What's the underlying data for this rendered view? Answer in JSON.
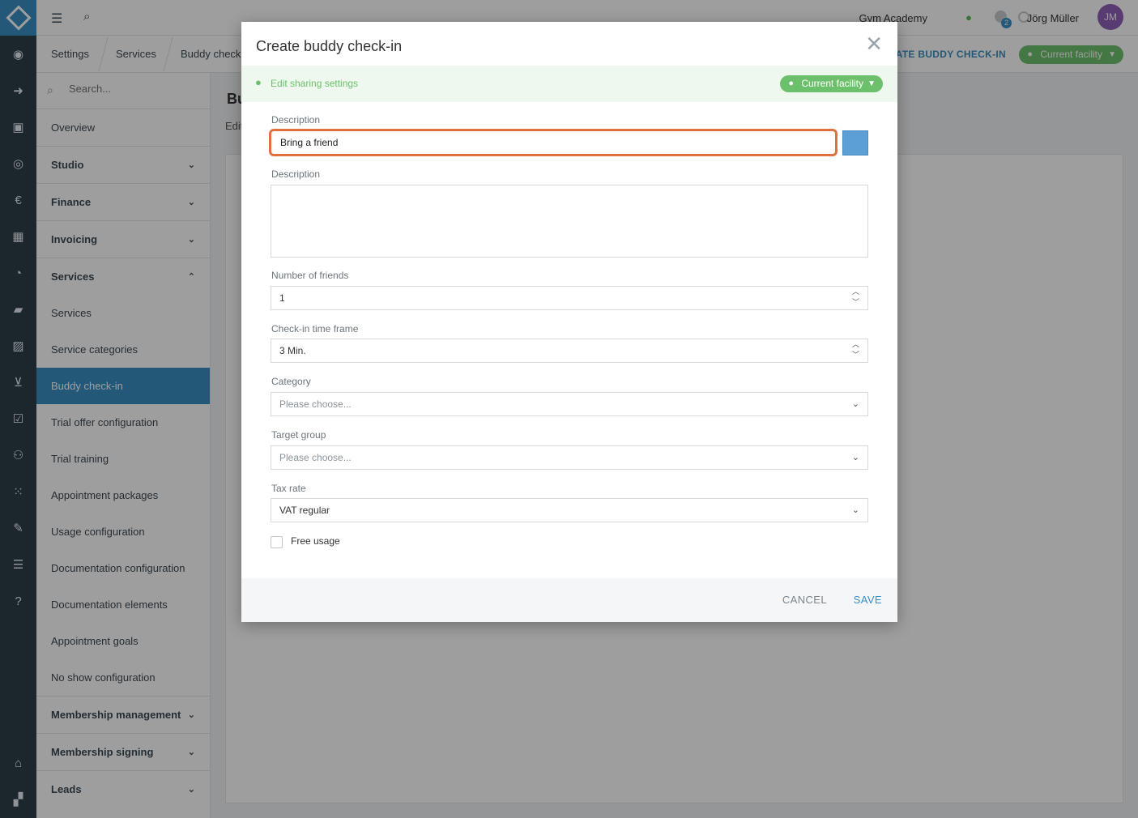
{
  "topbar": {
    "studio_name": "Gym Academy",
    "notifications_count": "2",
    "user_name": "Jörg Müller",
    "avatar_initials": "JM"
  },
  "breadcrumb": [
    "Settings",
    "Services",
    "Buddy check-i"
  ],
  "header_actions": {
    "create_label": "CREATE BUDDY CHECK-IN",
    "facility_label": "Current facility"
  },
  "sidebar": {
    "search_placeholder": "Search...",
    "overview": "Overview",
    "groups": {
      "studio": "Studio",
      "finance": "Finance",
      "invoicing": "Invoicing",
      "services": "Services",
      "membership_management": "Membership management",
      "membership_signing": "Membership signing",
      "leads": "Leads"
    },
    "service_items": [
      "Services",
      "Service categories",
      "Buddy check-in",
      "Trial offer configuration",
      "Trial training",
      "Appointment packages",
      "Usage configuration",
      "Documentation configuration",
      "Documentation elements",
      "Appointment goals",
      "No show configuration"
    ]
  },
  "main": {
    "page_title": "Bu",
    "page_sub": "Edit"
  },
  "modal": {
    "title": "Create buddy check-in",
    "sharing_link": "Edit sharing settings",
    "sharing_pill": "Current facility",
    "fields": {
      "name_label": "Description",
      "name_value": "Bring a friend",
      "swatch_color": "#5b9fd6",
      "description_label": "Description",
      "friends_label": "Number of friends",
      "friends_value": "1",
      "timeframe_label": "Check-in time frame",
      "timeframe_value": "3 Min.",
      "category_label": "Category",
      "category_placeholder": "Please choose...",
      "target_label": "Target group",
      "target_placeholder": "Please choose...",
      "tax_label": "Tax rate",
      "tax_value": "VAT regular",
      "free_usage_label": "Free usage"
    },
    "cancel_label": "CANCEL",
    "save_label": "SAVE"
  },
  "colors": {
    "accent": "#3a8fc4",
    "success": "#6cc06c",
    "focus_border": "#e07040",
    "rail": "#2c3e4a"
  }
}
